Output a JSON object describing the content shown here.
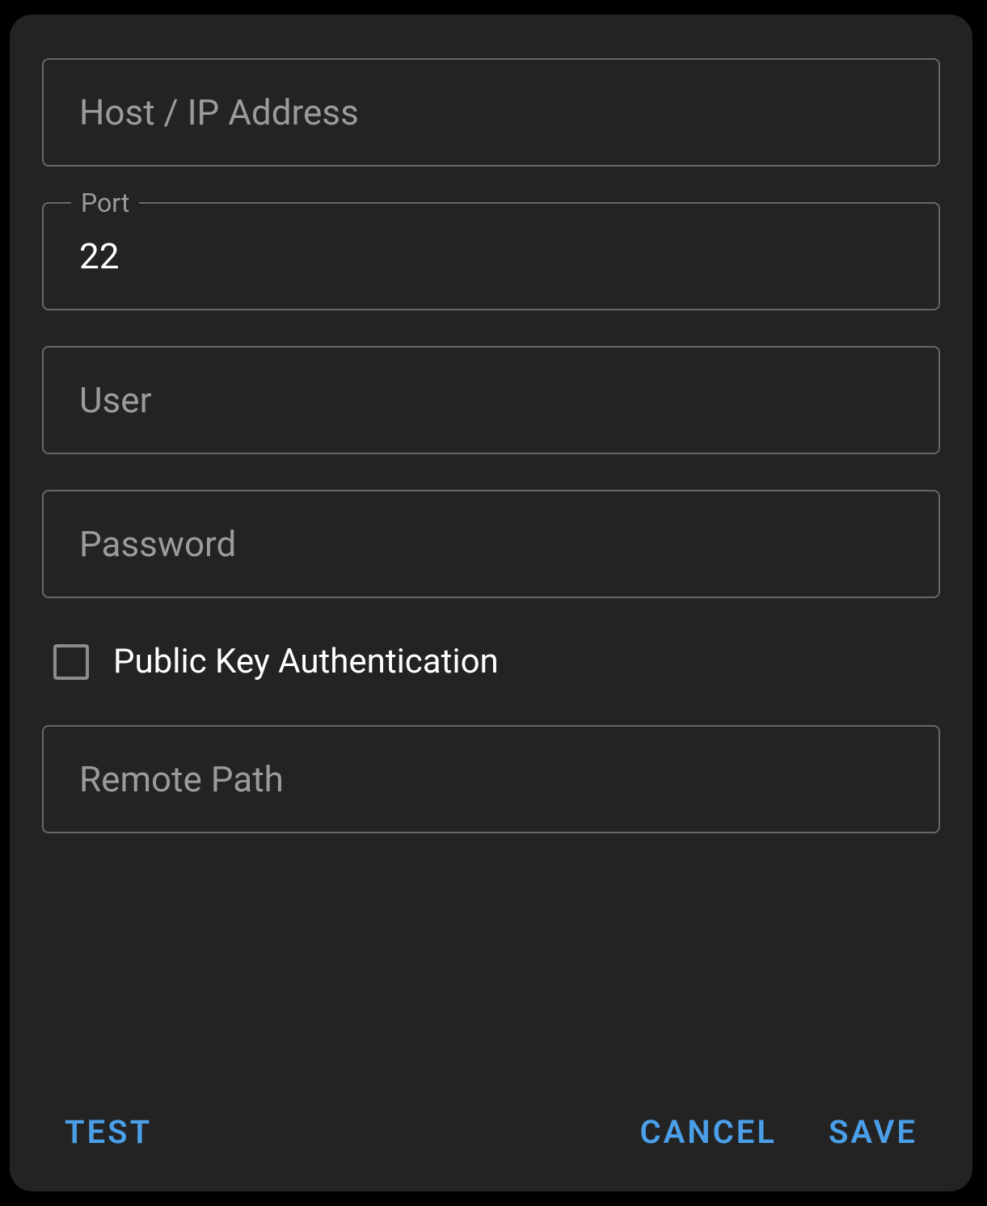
{
  "fields": {
    "host": {
      "placeholder": "Host / IP Address",
      "value": ""
    },
    "port": {
      "label": "Port",
      "value": "22"
    },
    "user": {
      "placeholder": "User",
      "value": ""
    },
    "password": {
      "placeholder": "Password",
      "value": ""
    },
    "remote_path": {
      "placeholder": "Remote Path",
      "value": ""
    }
  },
  "checkbox": {
    "public_key_auth": {
      "label": "Public Key Authentication",
      "checked": false
    }
  },
  "actions": {
    "test": "TEST",
    "cancel": "CANCEL",
    "save": "SAVE"
  }
}
